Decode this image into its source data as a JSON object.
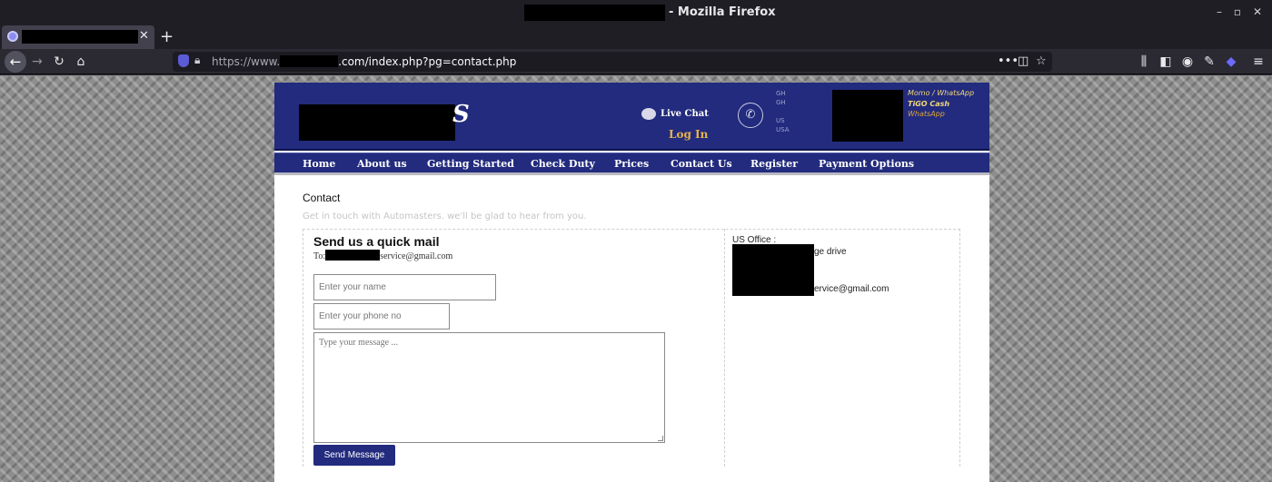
{
  "browser": {
    "window_title_suffix": "- Mozilla Firefox",
    "tab_close": "✕",
    "new_tab": "+",
    "url_prefix": "https://www.",
    "url_suffix": ".com/index.php?pg=contact.php",
    "win_buttons": [
      "–",
      "▫",
      "✕"
    ]
  },
  "header": {
    "logo_fragment": "S",
    "live_chat": "Live Chat",
    "log_in": "Log In",
    "contact_labels": [
      "GH",
      "GH",
      "",
      "US",
      "USA"
    ],
    "payment_lines": [
      "Momo / WhatsApp",
      "TiGO Cash",
      "WhatsApp"
    ]
  },
  "nav": {
    "items": [
      "Home",
      "About us",
      "Getting Started",
      "Check Duty",
      "Prices",
      "Contact Us",
      "Register",
      "Payment Options"
    ]
  },
  "content": {
    "title": "Contact",
    "subtitle": "Get in touch with Automasters. we'll be glad to hear from you.",
    "form": {
      "heading": "Send us a quick mail",
      "to_prefix": "To:",
      "to_suffix": "service@gmail.com",
      "name_placeholder": "Enter your name",
      "phone_placeholder": "Enter your phone no",
      "message_placeholder": "Type your message ...",
      "send_label": "Send Message"
    },
    "office": {
      "label": "US Office :",
      "address_fragment": "ge drive",
      "email_fragment": "ervice@gmail.com"
    }
  },
  "colors": {
    "brand_navy": "#222b7d",
    "accent_gold": "#e6b24a"
  }
}
